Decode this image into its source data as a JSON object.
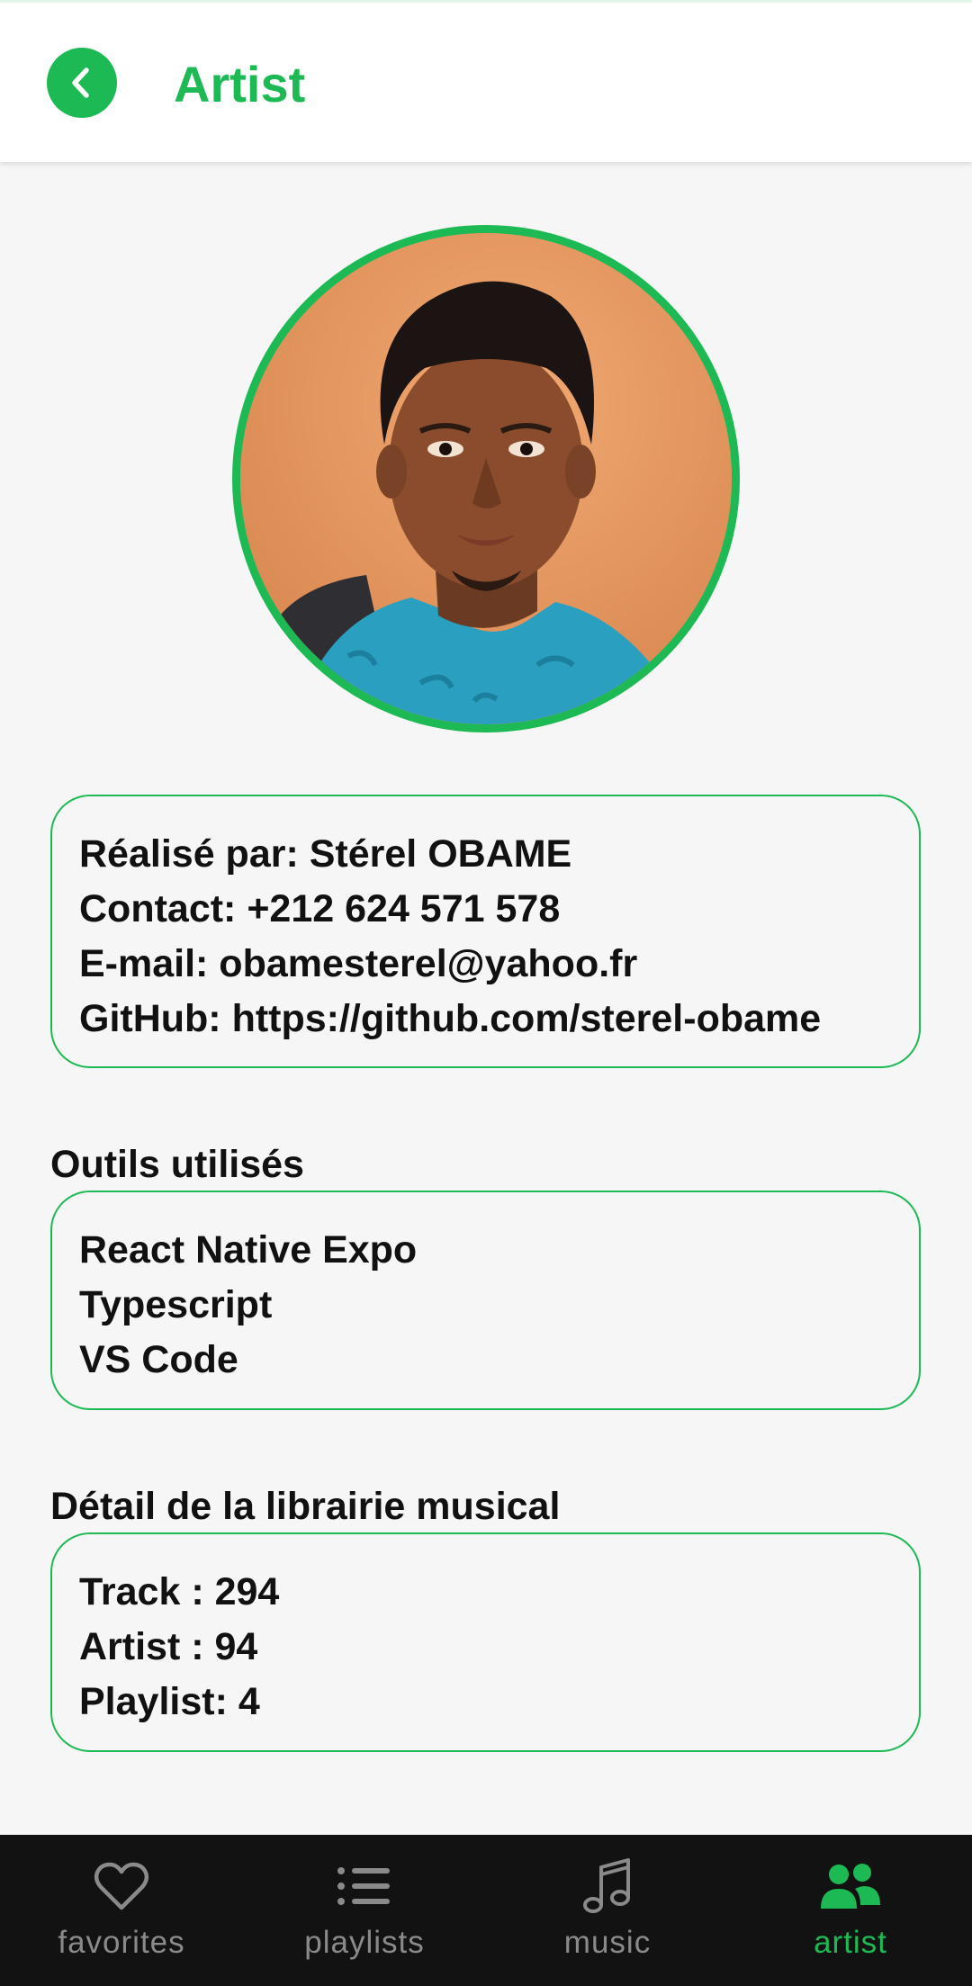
{
  "header": {
    "title": "Artist",
    "back_icon": "chevron-left-icon",
    "accent_color": "#1db954"
  },
  "profile": {
    "avatar_icon": "artist-portrait-photo"
  },
  "info_card": {
    "lines": [
      "Réalisé par: Stérel OBAME",
      "Contact: +212 624 571 578",
      "E-mail: obamesterel@yahoo.fr",
      "GitHub: https://github.com/sterel-obame"
    ]
  },
  "tools": {
    "title": "Outils utilisés",
    "items": [
      "React Native Expo",
      "Typescript",
      "VS Code"
    ]
  },
  "library": {
    "title": "Détail de la librairie musical",
    "items": [
      "Track : 294",
      "Artist : 94",
      "Playlist: 4"
    ]
  },
  "tabbar": {
    "tabs": [
      {
        "label": "favorites",
        "icon": "heart-icon",
        "active": false
      },
      {
        "label": "playlists",
        "icon": "list-icon",
        "active": false
      },
      {
        "label": "music",
        "icon": "music-note-icon",
        "active": false
      },
      {
        "label": "artist",
        "icon": "users-icon",
        "active": true
      }
    ],
    "background": "#121212",
    "inactive_color": "#8a8a8a",
    "active_color": "#1db954"
  }
}
